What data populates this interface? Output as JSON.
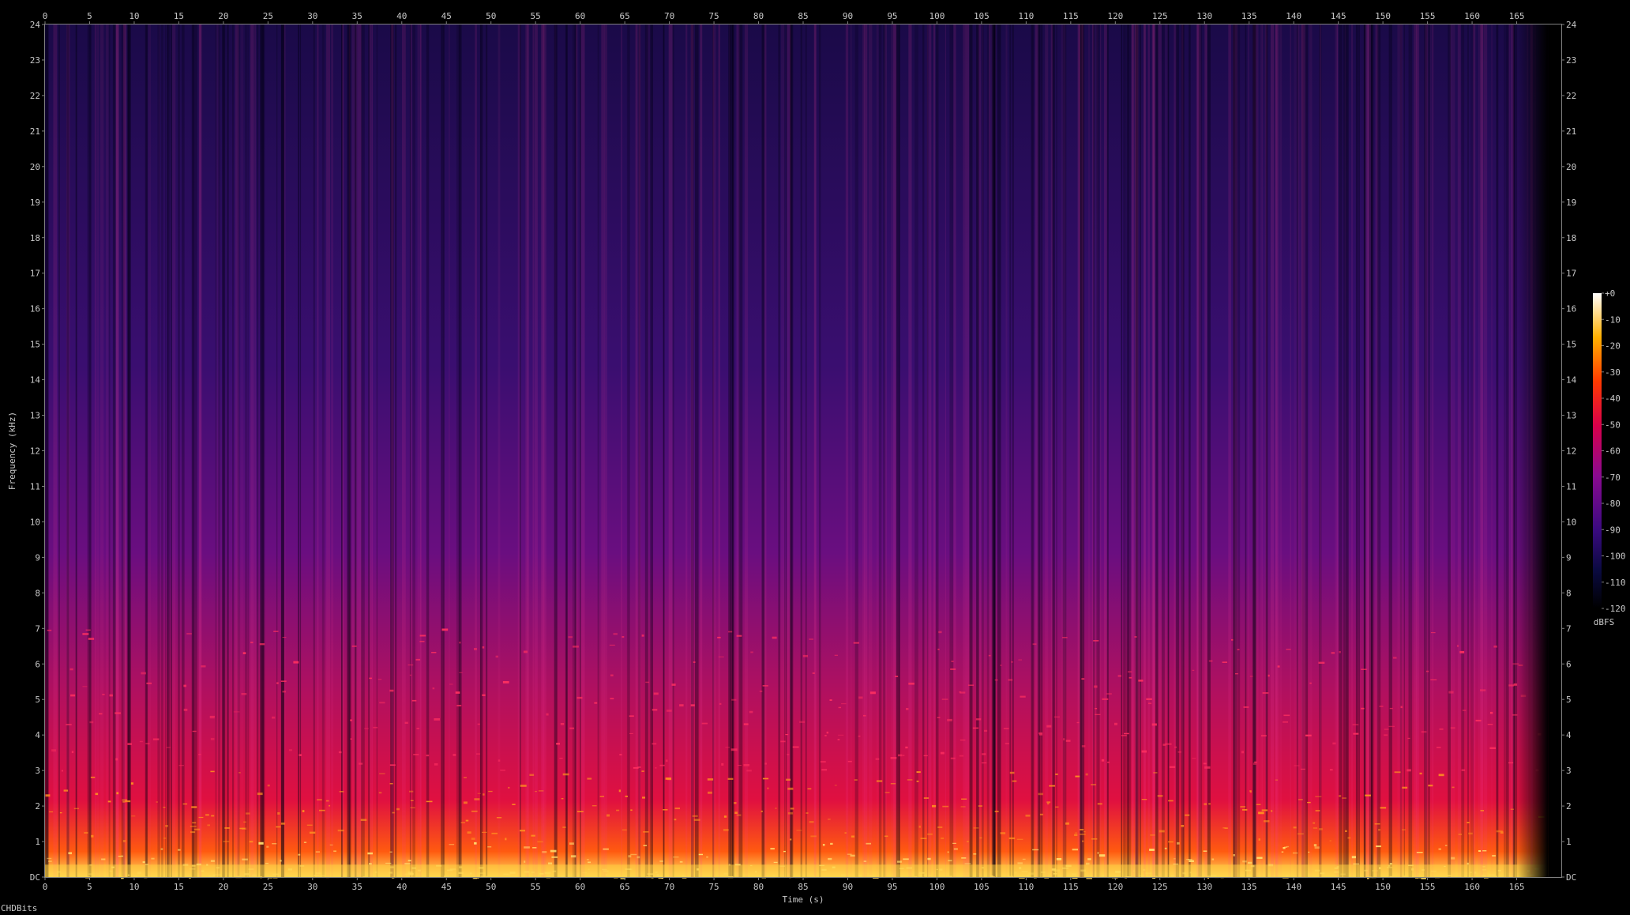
{
  "chart_data": {
    "type": "heatmap",
    "title": "",
    "xlabel": "Time (s)",
    "ylabel": "Frequency (kHz)",
    "xlim": [
      0,
      170
    ],
    "ylim": [
      0,
      24
    ],
    "x_ticks": [
      0,
      5,
      10,
      15,
      20,
      25,
      30,
      35,
      40,
      45,
      50,
      55,
      60,
      65,
      70,
      75,
      80,
      85,
      90,
      95,
      100,
      105,
      110,
      115,
      120,
      125,
      130,
      135,
      140,
      145,
      150,
      155,
      160,
      165
    ],
    "y_ticks": [
      "DC",
      "1",
      "2",
      "3",
      "4",
      "5",
      "6",
      "7",
      "8",
      "9",
      "10",
      "11",
      "12",
      "13",
      "14",
      "15",
      "16",
      "17",
      "18",
      "19",
      "20",
      "21",
      "22",
      "23",
      "24"
    ],
    "colorbar": {
      "label": "dBFS",
      "ticks": [
        "+0",
        "-10",
        "-20",
        "-30",
        "-40",
        "-50",
        "-60",
        "-70",
        "-80",
        "-90",
        "-100",
        "-110",
        "-120"
      ],
      "range": [
        -120,
        0
      ]
    },
    "audio_end_seconds": 168.5,
    "intensity_profile": [
      {
        "band_khz": "0-1",
        "level_dbfs": -25
      },
      {
        "band_khz": "1-3",
        "level_dbfs": -45
      },
      {
        "band_khz": "3-6",
        "level_dbfs": -60
      },
      {
        "band_khz": "6-10",
        "level_dbfs": -75
      },
      {
        "band_khz": "10-16",
        "level_dbfs": -90
      },
      {
        "band_khz": "16-24",
        "level_dbfs": -100
      }
    ],
    "colors": {
      "background": "#000000",
      "scale_low": "#000000",
      "scale_mid": "#cc0044",
      "scale_high": "#ffffff"
    }
  },
  "footer": {
    "text": "CHDBits"
  }
}
